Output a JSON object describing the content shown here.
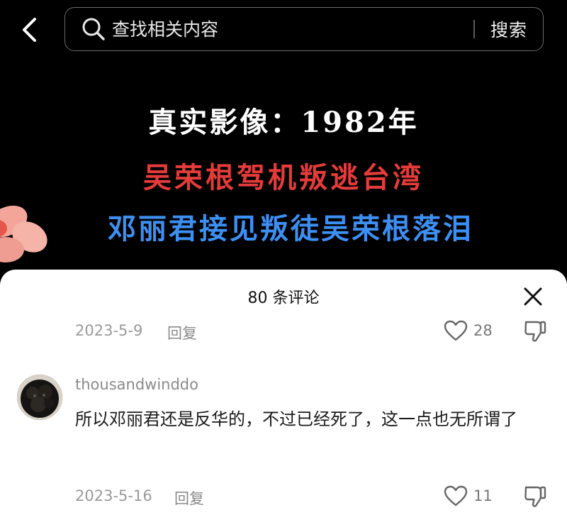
{
  "search": {
    "placeholder": "查找相关内容",
    "button_label": "搜索"
  },
  "video": {
    "caption_line1": "真实影像：1982年",
    "caption_line2": "吴荣根驾机叛逃台湾",
    "caption_line3": "邓丽君接见叛徒吴荣根落泪"
  },
  "comments_panel": {
    "title": "80 条评论",
    "comments": [
      {
        "date": "2023-5-9",
        "reply_label": "回复",
        "likes": "28"
      },
      {
        "username": "thousandwinddo",
        "text": "所以邓丽君还是反华的，不过已经死了，这一点也无所谓了",
        "date": "2023-5-16",
        "reply_label": "回复",
        "likes": "11"
      }
    ]
  },
  "colors": {
    "caption_white": "#ffffff",
    "caption_red": "#e53b3b",
    "caption_blue": "#3e8ff2",
    "sheet_bg": "#ffffff",
    "meta_gray": "#9a9a9a"
  },
  "icons": [
    "back-icon",
    "search-icon",
    "close-icon",
    "heart-icon",
    "thumbs-down-icon",
    "flower-sticker"
  ]
}
